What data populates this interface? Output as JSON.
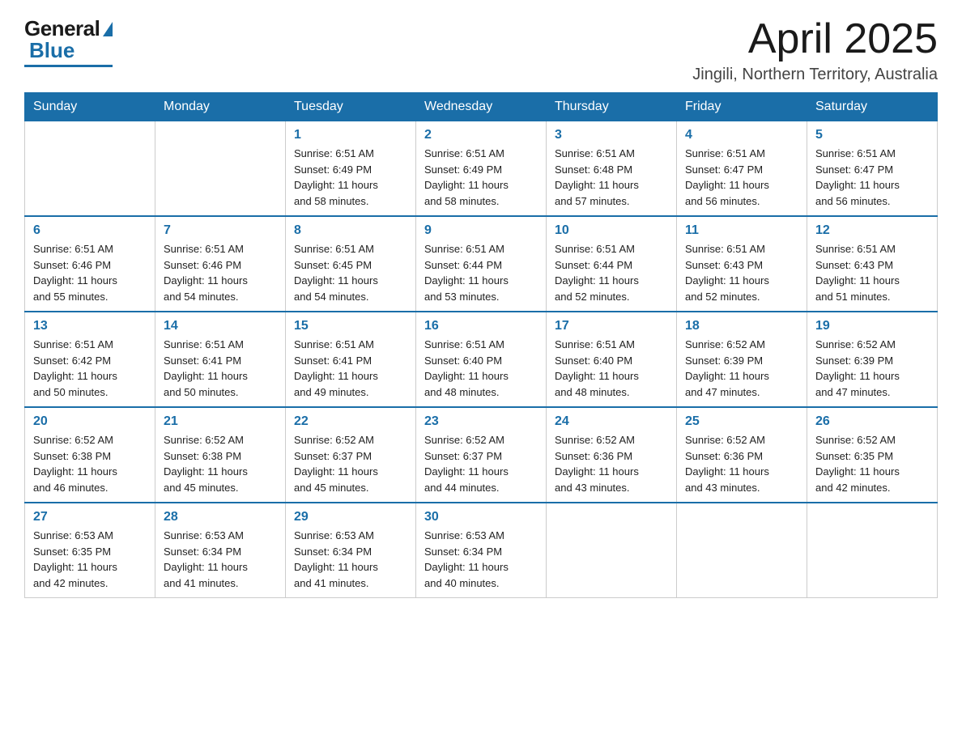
{
  "header": {
    "logo_general": "General",
    "logo_blue": "Blue",
    "month_title": "April 2025",
    "location": "Jingili, Northern Territory, Australia"
  },
  "days_of_week": [
    "Sunday",
    "Monday",
    "Tuesday",
    "Wednesday",
    "Thursday",
    "Friday",
    "Saturday"
  ],
  "weeks": [
    [
      {
        "day": "",
        "info": ""
      },
      {
        "day": "",
        "info": ""
      },
      {
        "day": "1",
        "info": "Sunrise: 6:51 AM\nSunset: 6:49 PM\nDaylight: 11 hours\nand 58 minutes."
      },
      {
        "day": "2",
        "info": "Sunrise: 6:51 AM\nSunset: 6:49 PM\nDaylight: 11 hours\nand 58 minutes."
      },
      {
        "day": "3",
        "info": "Sunrise: 6:51 AM\nSunset: 6:48 PM\nDaylight: 11 hours\nand 57 minutes."
      },
      {
        "day": "4",
        "info": "Sunrise: 6:51 AM\nSunset: 6:47 PM\nDaylight: 11 hours\nand 56 minutes."
      },
      {
        "day": "5",
        "info": "Sunrise: 6:51 AM\nSunset: 6:47 PM\nDaylight: 11 hours\nand 56 minutes."
      }
    ],
    [
      {
        "day": "6",
        "info": "Sunrise: 6:51 AM\nSunset: 6:46 PM\nDaylight: 11 hours\nand 55 minutes."
      },
      {
        "day": "7",
        "info": "Sunrise: 6:51 AM\nSunset: 6:46 PM\nDaylight: 11 hours\nand 54 minutes."
      },
      {
        "day": "8",
        "info": "Sunrise: 6:51 AM\nSunset: 6:45 PM\nDaylight: 11 hours\nand 54 minutes."
      },
      {
        "day": "9",
        "info": "Sunrise: 6:51 AM\nSunset: 6:44 PM\nDaylight: 11 hours\nand 53 minutes."
      },
      {
        "day": "10",
        "info": "Sunrise: 6:51 AM\nSunset: 6:44 PM\nDaylight: 11 hours\nand 52 minutes."
      },
      {
        "day": "11",
        "info": "Sunrise: 6:51 AM\nSunset: 6:43 PM\nDaylight: 11 hours\nand 52 minutes."
      },
      {
        "day": "12",
        "info": "Sunrise: 6:51 AM\nSunset: 6:43 PM\nDaylight: 11 hours\nand 51 minutes."
      }
    ],
    [
      {
        "day": "13",
        "info": "Sunrise: 6:51 AM\nSunset: 6:42 PM\nDaylight: 11 hours\nand 50 minutes."
      },
      {
        "day": "14",
        "info": "Sunrise: 6:51 AM\nSunset: 6:41 PM\nDaylight: 11 hours\nand 50 minutes."
      },
      {
        "day": "15",
        "info": "Sunrise: 6:51 AM\nSunset: 6:41 PM\nDaylight: 11 hours\nand 49 minutes."
      },
      {
        "day": "16",
        "info": "Sunrise: 6:51 AM\nSunset: 6:40 PM\nDaylight: 11 hours\nand 48 minutes."
      },
      {
        "day": "17",
        "info": "Sunrise: 6:51 AM\nSunset: 6:40 PM\nDaylight: 11 hours\nand 48 minutes."
      },
      {
        "day": "18",
        "info": "Sunrise: 6:52 AM\nSunset: 6:39 PM\nDaylight: 11 hours\nand 47 minutes."
      },
      {
        "day": "19",
        "info": "Sunrise: 6:52 AM\nSunset: 6:39 PM\nDaylight: 11 hours\nand 47 minutes."
      }
    ],
    [
      {
        "day": "20",
        "info": "Sunrise: 6:52 AM\nSunset: 6:38 PM\nDaylight: 11 hours\nand 46 minutes."
      },
      {
        "day": "21",
        "info": "Sunrise: 6:52 AM\nSunset: 6:38 PM\nDaylight: 11 hours\nand 45 minutes."
      },
      {
        "day": "22",
        "info": "Sunrise: 6:52 AM\nSunset: 6:37 PM\nDaylight: 11 hours\nand 45 minutes."
      },
      {
        "day": "23",
        "info": "Sunrise: 6:52 AM\nSunset: 6:37 PM\nDaylight: 11 hours\nand 44 minutes."
      },
      {
        "day": "24",
        "info": "Sunrise: 6:52 AM\nSunset: 6:36 PM\nDaylight: 11 hours\nand 43 minutes."
      },
      {
        "day": "25",
        "info": "Sunrise: 6:52 AM\nSunset: 6:36 PM\nDaylight: 11 hours\nand 43 minutes."
      },
      {
        "day": "26",
        "info": "Sunrise: 6:52 AM\nSunset: 6:35 PM\nDaylight: 11 hours\nand 42 minutes."
      }
    ],
    [
      {
        "day": "27",
        "info": "Sunrise: 6:53 AM\nSunset: 6:35 PM\nDaylight: 11 hours\nand 42 minutes."
      },
      {
        "day": "28",
        "info": "Sunrise: 6:53 AM\nSunset: 6:34 PM\nDaylight: 11 hours\nand 41 minutes."
      },
      {
        "day": "29",
        "info": "Sunrise: 6:53 AM\nSunset: 6:34 PM\nDaylight: 11 hours\nand 41 minutes."
      },
      {
        "day": "30",
        "info": "Sunrise: 6:53 AM\nSunset: 6:34 PM\nDaylight: 11 hours\nand 40 minutes."
      },
      {
        "day": "",
        "info": ""
      },
      {
        "day": "",
        "info": ""
      },
      {
        "day": "",
        "info": ""
      }
    ]
  ]
}
